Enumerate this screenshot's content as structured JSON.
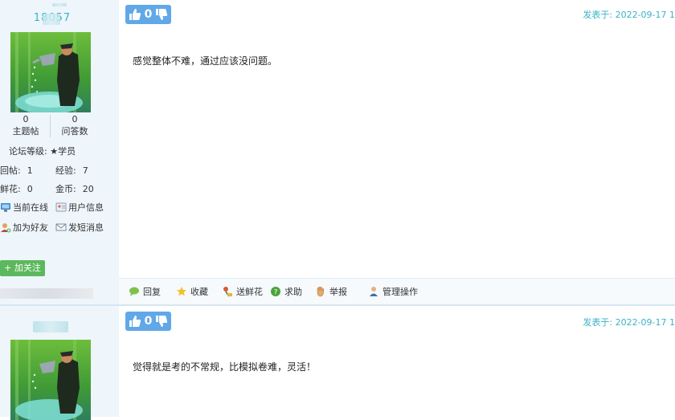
{
  "posts": [
    {
      "username": "18057",
      "stats": {
        "topics_value": "0",
        "topics_label": "主题帖",
        "answers_value": "0",
        "answers_label": "问答数"
      },
      "rank": "论坛等级: ★学员",
      "replies_label": "回帖:",
      "replies_value": "1",
      "exp_label": "经验:",
      "exp_value": "7",
      "flowers_label": "鲜花:",
      "flowers_value": "0",
      "coins_label": "金币:",
      "coins_value": "20",
      "actions": {
        "online": "当前在线",
        "user_info": "用户信息",
        "add_friend": "加为好友",
        "send_message": "发短消息"
      },
      "follow_label": "+ 加关注",
      "vote_count": "0",
      "date": "发表于: 2022-09-17 1",
      "content": "感觉整体不难，通过应该没问题。",
      "toolbar": {
        "reply": "回复",
        "favorite": "收藏",
        "flower": "送鲜花",
        "help": "求助",
        "report": "举报",
        "manage": "管理操作"
      }
    },
    {
      "username": "",
      "vote_count": "0",
      "date": "发表于: 2022-09-17 1",
      "content": "觉得就是考的不常规，比模拟卷难，灵活！"
    }
  ],
  "colors": {
    "accent": "#39b3c7",
    "vote": "#61a8e8",
    "follow": "#5cb85c",
    "sidebar_bg": "#eef5fb"
  }
}
